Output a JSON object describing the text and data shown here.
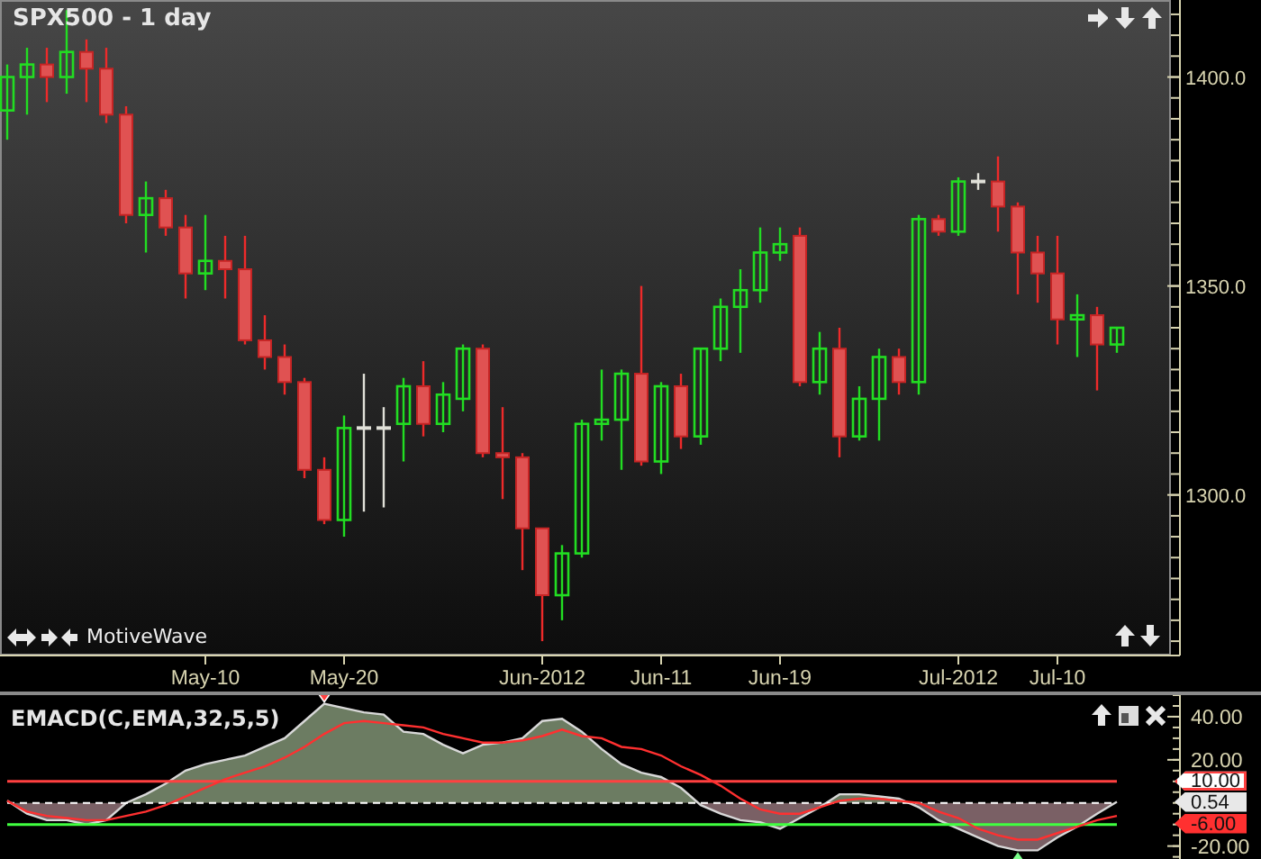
{
  "price_panel": {
    "title": "SPX500 - 1 day",
    "brand": "MotiveWave",
    "chart_data": {
      "type": "candlestick",
      "ylim": [
        1262,
        1418
      ],
      "yticks": [
        {
          "value": 1400,
          "label": "1400.0"
        },
        {
          "value": 1350,
          "label": "1350.0"
        },
        {
          "value": 1300,
          "label": "1300.0"
        }
      ],
      "categories": [
        null,
        null,
        null,
        null,
        null,
        null,
        null,
        null,
        null,
        null,
        "May-10",
        null,
        null,
        null,
        null,
        null,
        null,
        "May-20",
        null,
        null,
        null,
        null,
        null,
        null,
        null,
        null,
        null,
        "Jun-2012",
        null,
        null,
        null,
        null,
        null,
        "Jun-11",
        null,
        null,
        null,
        null,
        null,
        "Jun-19",
        null,
        null,
        null,
        null,
        null,
        null,
        null,
        null,
        "Jul-2012",
        null,
        null,
        null,
        null,
        "Jul-10",
        null,
        null,
        null
      ],
      "ohlc": [
        [
          1392,
          1403,
          1385,
          1400
        ],
        [
          1400,
          1407,
          1391,
          1403
        ],
        [
          1403,
          1407,
          1394,
          1400
        ],
        [
          1400,
          1416,
          1396,
          1406
        ],
        [
          1406,
          1409,
          1394,
          1402
        ],
        [
          1402,
          1407,
          1389,
          1391
        ],
        [
          1391,
          1393,
          1365,
          1367
        ],
        [
          1367,
          1375,
          1358,
          1371
        ],
        [
          1371,
          1373,
          1362,
          1364
        ],
        [
          1364,
          1367,
          1347,
          1353
        ],
        [
          1353,
          1367,
          1349,
          1356
        ],
        [
          1356,
          1362,
          1347,
          1354
        ],
        [
          1354,
          1362,
          1336,
          1337
        ],
        [
          1337,
          1343,
          1330,
          1333
        ],
        [
          1333,
          1336,
          1324,
          1327
        ],
        [
          1327,
          1328,
          1304,
          1306
        ],
        [
          1306,
          1309,
          1293,
          1294
        ],
        [
          1294,
          1319,
          1290,
          1316
        ],
        [
          1316,
          1329,
          1296,
          1316
        ],
        [
          1316,
          1321,
          1297,
          1316
        ],
        [
          1317,
          1328,
          1308,
          1326
        ],
        [
          1326,
          1332,
          1314,
          1317
        ],
        [
          1317,
          1327,
          1315,
          1324
        ],
        [
          1323,
          1336,
          1320,
          1335
        ],
        [
          1335,
          1336,
          1309,
          1310
        ],
        [
          1310,
          1321,
          1299,
          1309
        ],
        [
          1309,
          1310,
          1282,
          1292
        ],
        [
          1292,
          1292,
          1265,
          1276
        ],
        [
          1276,
          1288,
          1270,
          1286
        ],
        [
          1286,
          1318,
          1285,
          1317
        ],
        [
          1317,
          1330,
          1313,
          1318
        ],
        [
          1318,
          1330,
          1306,
          1329
        ],
        [
          1329,
          1350,
          1307,
          1308
        ],
        [
          1308,
          1327,
          1305,
          1326
        ],
        [
          1326,
          1329,
          1311,
          1314
        ],
        [
          1314,
          1335,
          1312,
          1335
        ],
        [
          1335,
          1347,
          1332,
          1345
        ],
        [
          1345,
          1354,
          1334,
          1349
        ],
        [
          1349,
          1364,
          1346,
          1358
        ],
        [
          1358,
          1364,
          1356,
          1360
        ],
        [
          1362,
          1364,
          1326,
          1327
        ],
        [
          1327,
          1339,
          1324,
          1335
        ],
        [
          1335,
          1340,
          1309,
          1314
        ],
        [
          1314,
          1326,
          1313,
          1323
        ],
        [
          1323,
          1335,
          1313,
          1333
        ],
        [
          1333,
          1335,
          1324,
          1327
        ],
        [
          1327,
          1367,
          1324,
          1366
        ],
        [
          1366,
          1367,
          1362,
          1363
        ],
        [
          1363,
          1376,
          1362,
          1375
        ],
        [
          1375,
          1377,
          1373,
          1375
        ],
        [
          1375,
          1381,
          1363,
          1369
        ],
        [
          1369,
          1370,
          1348,
          1358
        ],
        [
          1358,
          1362,
          1346,
          1353
        ],
        [
          1353,
          1362,
          1336,
          1342
        ],
        [
          1342,
          1348,
          1333,
          1343
        ],
        [
          1343,
          1345,
          1325,
          1336
        ],
        [
          1336,
          1340,
          1334,
          1340
        ]
      ]
    }
  },
  "indicator_panel": {
    "title": "EMACD(C,EMA,32,5,5)",
    "last_value_labels": [
      "10.00",
      "0.54",
      "-6.00"
    ],
    "chart_data": {
      "type": "area",
      "ylim": [
        -26,
        50
      ],
      "yticks": [
        {
          "value": 40,
          "label": "40.00"
        },
        {
          "value": 20,
          "label": "20.00"
        },
        {
          "value": -20,
          "label": "-20.00"
        }
      ],
      "series": [
        {
          "type": "line",
          "color": "#ff4040",
          "values": [
            10,
            10,
            10,
            10,
            10,
            10,
            10,
            10,
            10,
            10,
            10,
            10,
            10,
            10,
            10,
            10,
            10,
            10,
            10,
            10,
            10,
            10,
            10,
            10,
            10,
            10,
            10,
            10,
            10,
            10,
            10,
            10,
            10,
            10,
            10,
            10,
            10,
            10,
            10,
            10,
            10,
            10,
            10,
            10,
            10,
            10,
            10,
            10,
            10,
            10,
            10,
            10,
            10,
            10,
            10,
            10,
            10
          ]
        },
        {
          "type": "area",
          "color": "#d8d8d8",
          "values": [
            1,
            -5,
            -8,
            -8,
            -10,
            -8,
            0,
            4,
            9,
            15,
            18,
            20,
            22,
            26,
            30,
            38,
            46,
            44,
            42,
            41,
            33,
            32,
            27,
            23,
            27,
            28,
            30,
            38,
            39,
            33,
            25,
            18,
            14,
            12,
            7,
            -1,
            -5,
            -8,
            -9,
            -12,
            -7,
            -2,
            4,
            4,
            3,
            2,
            -2,
            -8,
            -12,
            -16,
            -20,
            -22,
            -22,
            -16,
            -11,
            -5,
            0.5
          ]
        },
        {
          "type": "line",
          "color": "#ff3030",
          "values": [
            1,
            -4,
            -6,
            -7,
            -8,
            -8,
            -6,
            -4,
            -1,
            3,
            7,
            11,
            14,
            17,
            21,
            26,
            32,
            37,
            38,
            37,
            36,
            35,
            32,
            30,
            28,
            28,
            29,
            31,
            34,
            31,
            30,
            26,
            25,
            22,
            17,
            13,
            8,
            2,
            -3,
            -5,
            -5,
            -2,
            1,
            2,
            2,
            1,
            0,
            -4,
            -7,
            -12,
            -15,
            -17,
            -17,
            -14,
            -11,
            -8,
            -6
          ]
        },
        {
          "type": "line",
          "color": "#ffffff",
          "line_style": "dashed",
          "values": [
            0,
            0,
            0,
            0,
            0,
            0,
            0,
            0,
            0,
            0,
            0,
            0,
            0,
            0,
            0,
            0,
            0,
            0,
            0,
            0,
            0,
            0,
            0,
            0,
            0,
            0,
            0,
            0,
            0,
            0,
            0,
            0,
            0,
            0,
            0,
            0,
            0,
            0,
            0,
            0,
            0,
            0,
            0,
            0,
            0,
            0,
            0,
            0,
            0,
            0,
            0,
            0,
            0,
            0,
            0,
            0,
            0
          ]
        },
        {
          "type": "line",
          "color": "#40ff40",
          "values": [
            -10,
            -10,
            -10,
            -10,
            -10,
            -10,
            -10,
            -10,
            -10,
            -10,
            -10,
            -10,
            -10,
            -10,
            -10,
            -10,
            -10,
            -10,
            -10,
            -10,
            -10,
            -10,
            -10,
            -10,
            -10,
            -10,
            -10,
            -10,
            -10,
            -10,
            -10,
            -10,
            -10,
            -10,
            -10,
            -10,
            -10,
            -10,
            -10,
            -10,
            -10,
            -10,
            -10,
            -10,
            -10,
            -10,
            -10,
            -10,
            -10,
            -10,
            -10,
            -10,
            -10,
            -10,
            -10,
            -10,
            -10
          ]
        }
      ]
    }
  }
}
